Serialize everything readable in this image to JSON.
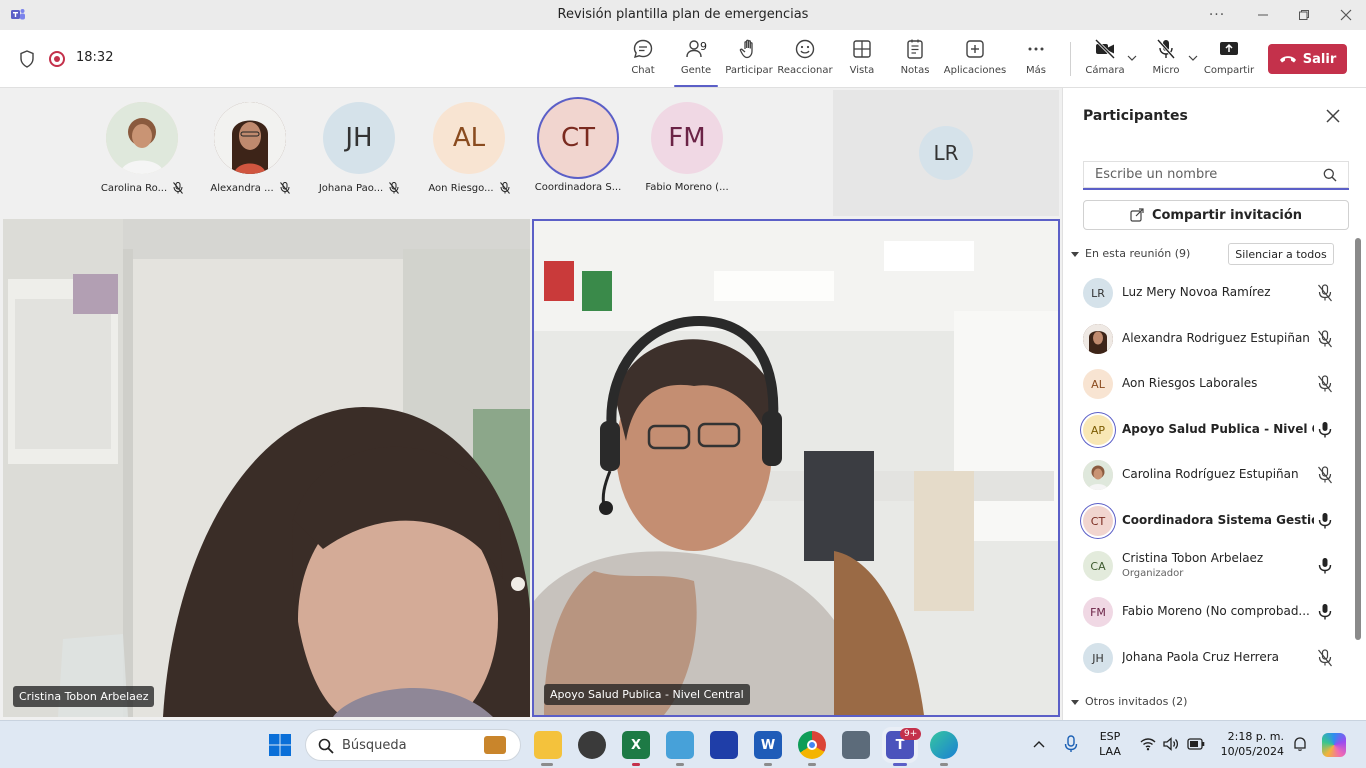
{
  "window": {
    "title": "Revisión plantilla plan de emergencias",
    "more_glyph": "···"
  },
  "toolbar": {
    "timer": "18:32",
    "people_count": "9",
    "buttons": {
      "chat": "Chat",
      "people": "Gente",
      "raise": "Participar",
      "react": "Reaccionar",
      "view": "Vista",
      "notes": "Notas",
      "apps": "Aplicaciones",
      "more": "Más",
      "camera": "Cámara",
      "mic": "Micro",
      "share": "Compartir"
    },
    "leave": "Salir"
  },
  "strip": [
    {
      "name": "Carolina Ro...",
      "initials": "",
      "color": "#e9d6c8",
      "photo": true
    },
    {
      "name": "Alexandra ...",
      "initials": "",
      "color": "#6e4a3a",
      "photo": true
    },
    {
      "name": "Johana Pao...",
      "initials": "JH",
      "color": "#d5e2ea"
    },
    {
      "name": "Aon Riesgo...",
      "initials": "AL",
      "color": "#f8e4d2"
    },
    {
      "name": "Coordinadora S...",
      "initials": "CT",
      "color": "#f1d5cf"
    },
    {
      "name": "Fabio Moreno (...",
      "initials": "FM",
      "color": "#f0d8e4"
    }
  ],
  "lr_tile": {
    "initials": "LR"
  },
  "videos": {
    "left": {
      "name": "Cristina Tobon Arbelaez"
    },
    "right": {
      "name": "Apoyo Salud Publica - Nivel Central"
    }
  },
  "panel": {
    "title": "Participantes",
    "search_placeholder": "Escribe un nombre",
    "share_invite": "Compartir invitación",
    "in_meeting": "En esta reunión (9)",
    "mute_all": "Silenciar a todos",
    "others": "Otros invitados (2)",
    "participants": [
      {
        "initials": "LR",
        "name": "Luz Mery Novoa Ramírez",
        "role": "",
        "muted": true,
        "bold": false,
        "color": "#d5e2ea"
      },
      {
        "initials": "",
        "name": "Alexandra Rodriguez Estupiñan",
        "role": "",
        "muted": true,
        "bold": false,
        "color": "#6e4a3a"
      },
      {
        "initials": "AL",
        "name": "Aon Riesgos Laborales",
        "role": "",
        "muted": true,
        "bold": false,
        "color": "#f8e4d2"
      },
      {
        "initials": "AP",
        "name": "Apoyo Salud Publica - Nivel C...",
        "role": "",
        "muted": false,
        "bold": true,
        "color": "#f8e7b5"
      },
      {
        "initials": "",
        "name": "Carolina Rodríguez Estupiñan",
        "role": "",
        "muted": true,
        "bold": false,
        "color": "#e9d6c8"
      },
      {
        "initials": "CT",
        "name": "Coordinadora Sistema Gestió...",
        "role": "",
        "muted": false,
        "bold": true,
        "color": "#f1d5cf"
      },
      {
        "initials": "CA",
        "name": "Cristina Tobon Arbelaez",
        "role": "Organizador",
        "muted": false,
        "bold": false,
        "color": "#e3ebdc"
      },
      {
        "initials": "FM",
        "name": "Fabio Moreno (No comprobad...",
        "role": "",
        "muted": false,
        "bold": false,
        "color": "#f0d8e4"
      },
      {
        "initials": "JH",
        "name": "Johana Paola Cruz Herrera",
        "role": "",
        "muted": true,
        "bold": false,
        "color": "#d5e2ea"
      }
    ]
  },
  "taskbar": {
    "search": "Búsqueda",
    "lang1": "ESP",
    "lang2": "LAA",
    "time": "2:18 p. m.",
    "date": "10/05/2024",
    "badge": "9+"
  }
}
